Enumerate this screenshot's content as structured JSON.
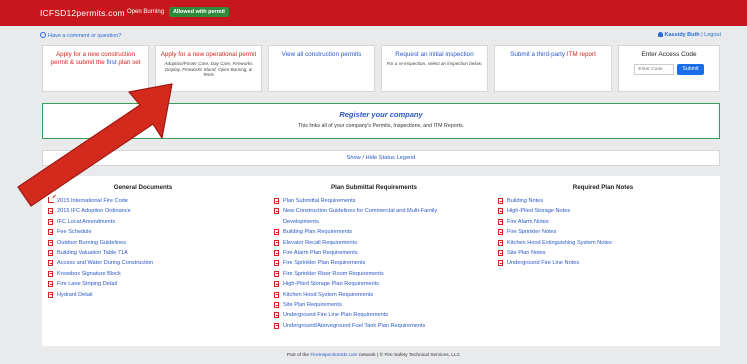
{
  "header": {
    "brand": "ICFSD12permits.com",
    "burn_label": "Open Burning",
    "burn_status": "Allowed with permit"
  },
  "links": {
    "comment": "Have a comment or question?",
    "user_name": "Kassidy Buth",
    "separator": " | ",
    "logout": "Logout"
  },
  "cards": {
    "construction": {
      "line1": "Apply for a new construction",
      "line2_pre": "permit & submit the ",
      "line2_hl": "first",
      "line2_post": " plan set"
    },
    "operational": {
      "title": "Apply for a new operational permit",
      "sub": "Adoption/Foster Care, Day Care, Fireworks Display, Fireworks Stand, Open Burning, & Tents"
    },
    "view_all": {
      "title": "View all construction permits"
    },
    "inspection": {
      "title": "Request an initial inspection",
      "sub": "For a re-inspection, select an inspection below."
    },
    "itm": {
      "title_pre": "Submit a third-party ",
      "title_hl": "ITM report"
    },
    "access": {
      "title": "Enter Access Code",
      "placeholder": "Enter Code",
      "submit": "Submit"
    }
  },
  "register": {
    "title": "Register your company",
    "text": "This links all of your company's Permits, Inspections, and ITM Reports."
  },
  "status_legend": "Show / Hide Status Legend",
  "documents": {
    "general": {
      "title": "General Documents",
      "items": [
        "2015 International Fire Code",
        "2015 IFC Adoption Ordinance",
        "IFC Local Amendments",
        "Fee Schedule",
        "Outdoor Burning Guidelines",
        "Building Valuation Table 71A",
        "Access and Water During Construction",
        "Knowbox Signature Block",
        "Fire Lane Striping Detail",
        "Hydrant Detail"
      ]
    },
    "plan_submittal": {
      "title": "Plan Submittal Requirements",
      "items": [
        "Plan Submittal Requirements",
        "New Construction Guidelines for Commercial and Multi-Family Developments",
        "Building Plan Requirements",
        "Elevator Recall Requirements",
        "Fire Alarm Plan Requirements",
        "Fire Sprinkler Plan Requirements",
        "Fire Sprinkler Riser Room Requirements",
        "High-Piled Storage Plan Requirements",
        "Kitchen Hood System Requirements",
        "Site Plan Requirements",
        "Underground Fire Line Plan Requirements",
        "Underground/Aboveground Fuel Tank Plan Requirements"
      ]
    },
    "plan_notes": {
      "title": "Required Plan Notes",
      "items": [
        "Building Notes",
        "High-Piled Storage Notes",
        "Fire Alarm Notes",
        "Fire Sprinkler Notes",
        "Kitchen Hood Extinguishing System Notes",
        "Site Plan Notes",
        "Underground Fire Line Notes"
      ]
    }
  },
  "footer": {
    "pre": "Part of the ",
    "link": "FireInspectionSD.com",
    "post": " network | © Fire Safety Technical Services, LLC"
  },
  "colors": {
    "header_red": "#c8171c",
    "link_blue": "#2b57c9",
    "register_border": "#3c9b5a",
    "arrow_red": "#d42a1e"
  }
}
